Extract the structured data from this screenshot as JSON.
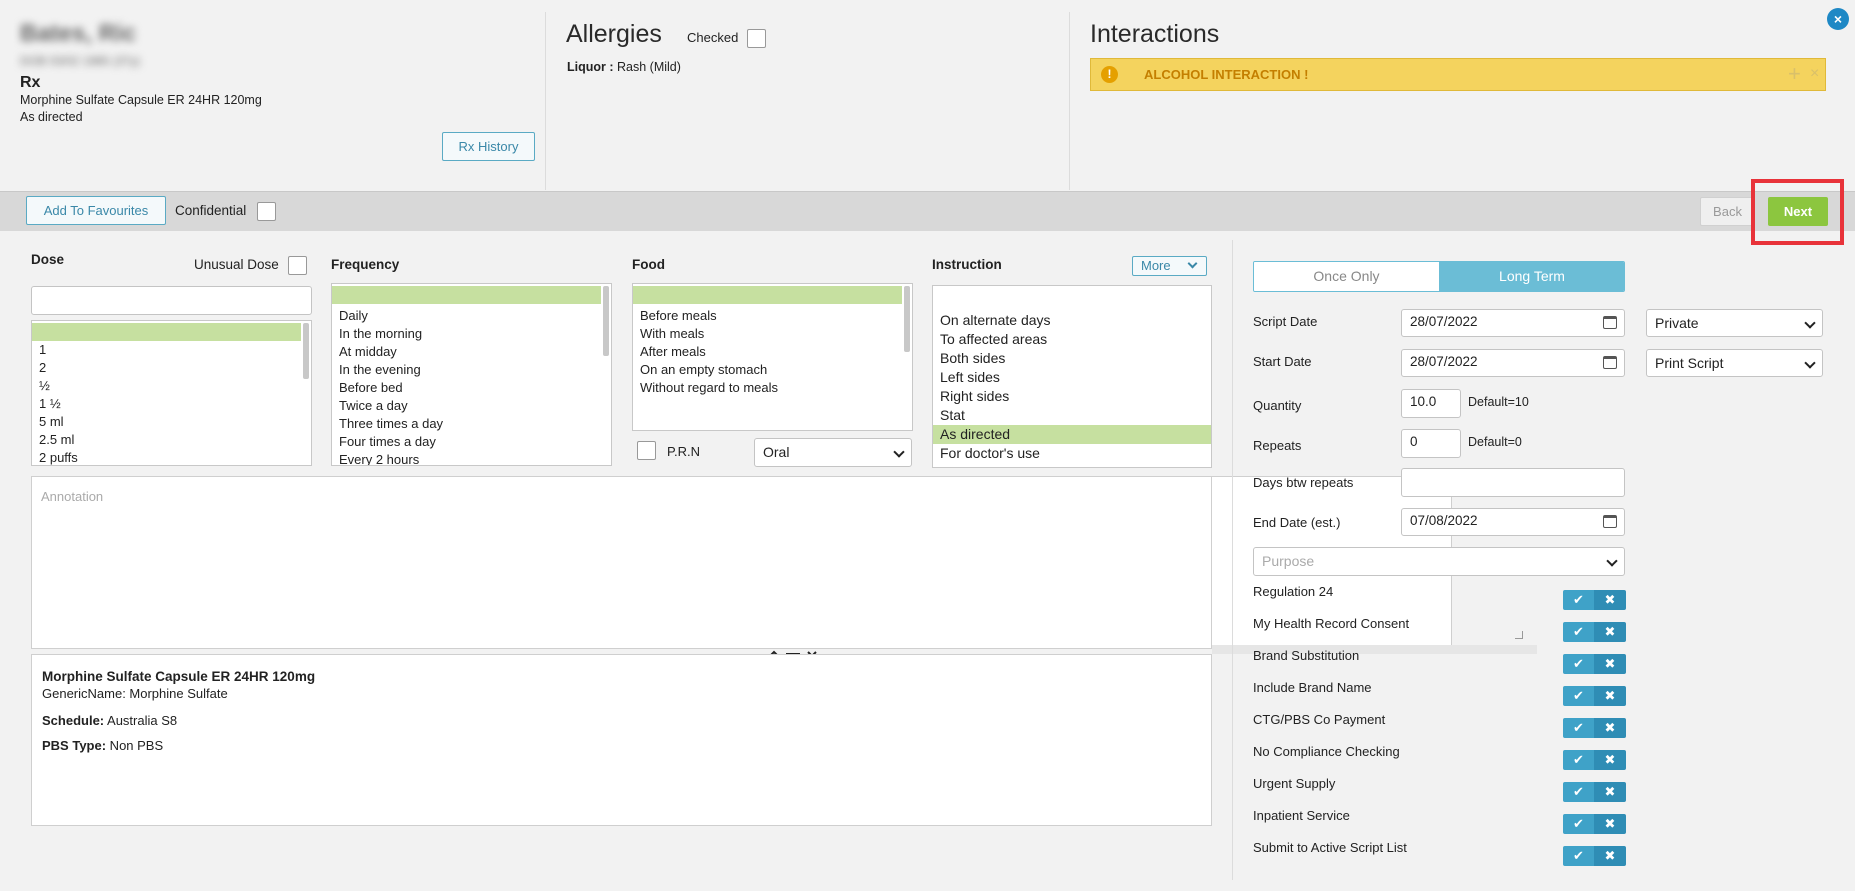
{
  "patient": {
    "name": "Bates, Ric",
    "details": "DOB 03/02 1985 (37y)",
    "rx_heading": "Rx",
    "drug": "Morphine Sulfate Capsule ER 24HR 120mg",
    "directions": "As directed",
    "rx_history_label": "Rx History"
  },
  "allergies": {
    "title": "Allergies",
    "checked_label": "Checked",
    "item_name": "Liquor",
    "item_sep": " : ",
    "item_reaction": "Rash (Mild)"
  },
  "interactions": {
    "title": "Interactions",
    "alert_icon": "!",
    "alert_text": "ALCOHOL INTERACTION !",
    "add_icon": "+",
    "dismiss_icon": "×"
  },
  "window": {
    "close_icon": "×"
  },
  "toolbar": {
    "add_favourites": "Add To Favourites",
    "confidential": "Confidential",
    "back": "Back",
    "next": "Next"
  },
  "dose": {
    "label": "Dose",
    "unusual_label": "Unusual Dose",
    "input_value": "",
    "items": [
      "",
      "1",
      "2",
      "½",
      "1 ½",
      "5 ml",
      "2.5 ml",
      "2 puffs"
    ]
  },
  "frequency": {
    "label": "Frequency",
    "items": [
      "",
      "Daily",
      "In the morning",
      "At midday",
      "In the evening",
      "Before bed",
      "Twice a day",
      "Three times a day",
      "Four times a day",
      "Every 2 hours"
    ]
  },
  "food": {
    "label": "Food",
    "items": [
      "",
      "Before meals",
      "With meals",
      "After meals",
      "On an empty stomach",
      "Without regard to meals"
    ],
    "prn_label": "P.R.N",
    "route_value": "Oral"
  },
  "instruction": {
    "label": "Instruction",
    "more_label": "More",
    "items": [
      "",
      "On alternate days",
      "To affected areas",
      "Both sides",
      "Left sides",
      "Right sides",
      "Stat",
      "As directed",
      "For doctor's use"
    ],
    "selected_index": 7
  },
  "annotation": {
    "placeholder": "Annotation"
  },
  "drug_info": {
    "name": "Morphine Sulfate Capsule ER 24HR 120mg",
    "generic": "GenericName: Morphine Sulfate",
    "schedule_label": "Schedule:",
    "schedule_value": " Australia S8",
    "pbs_label": "PBS Type:",
    "pbs_value": " Non PBS"
  },
  "script": {
    "once_only": "Once Only",
    "long_term": "Long Term",
    "script_date_label": "Script Date",
    "script_date": "28/07/2022",
    "start_date_label": "Start Date",
    "start_date": "28/07/2022",
    "private_value": "Private",
    "print_value": "Print Script",
    "quantity_label": "Quantity",
    "quantity": "10.0",
    "quantity_default": "Default=10",
    "repeats_label": "Repeats",
    "repeats": "0",
    "repeats_default": "Default=0",
    "days_label": "Days btw repeats",
    "days_value": "",
    "end_date_label": "End Date (est.)",
    "end_date": "07/08/2022",
    "purpose_placeholder": "Purpose"
  },
  "toggles": [
    {
      "label": "Regulation 24"
    },
    {
      "label": "My Health Record Consent"
    },
    {
      "label": "Brand Substitution"
    },
    {
      "label": "Include Brand Name"
    },
    {
      "label": "CTG/PBS Co Payment"
    },
    {
      "label": "No Compliance Checking"
    },
    {
      "label": "Urgent Supply"
    },
    {
      "label": "Inpatient Service"
    },
    {
      "label": "Submit to Active Script List"
    }
  ],
  "toggle_icons": {
    "yes": "✔",
    "no": "✖"
  },
  "colors": {
    "accent": "#6bbdd6",
    "selected_row": "#c6e0a0",
    "next": "#8cc63f",
    "alert": "#f4d35e",
    "highlight": "#e8333a"
  }
}
